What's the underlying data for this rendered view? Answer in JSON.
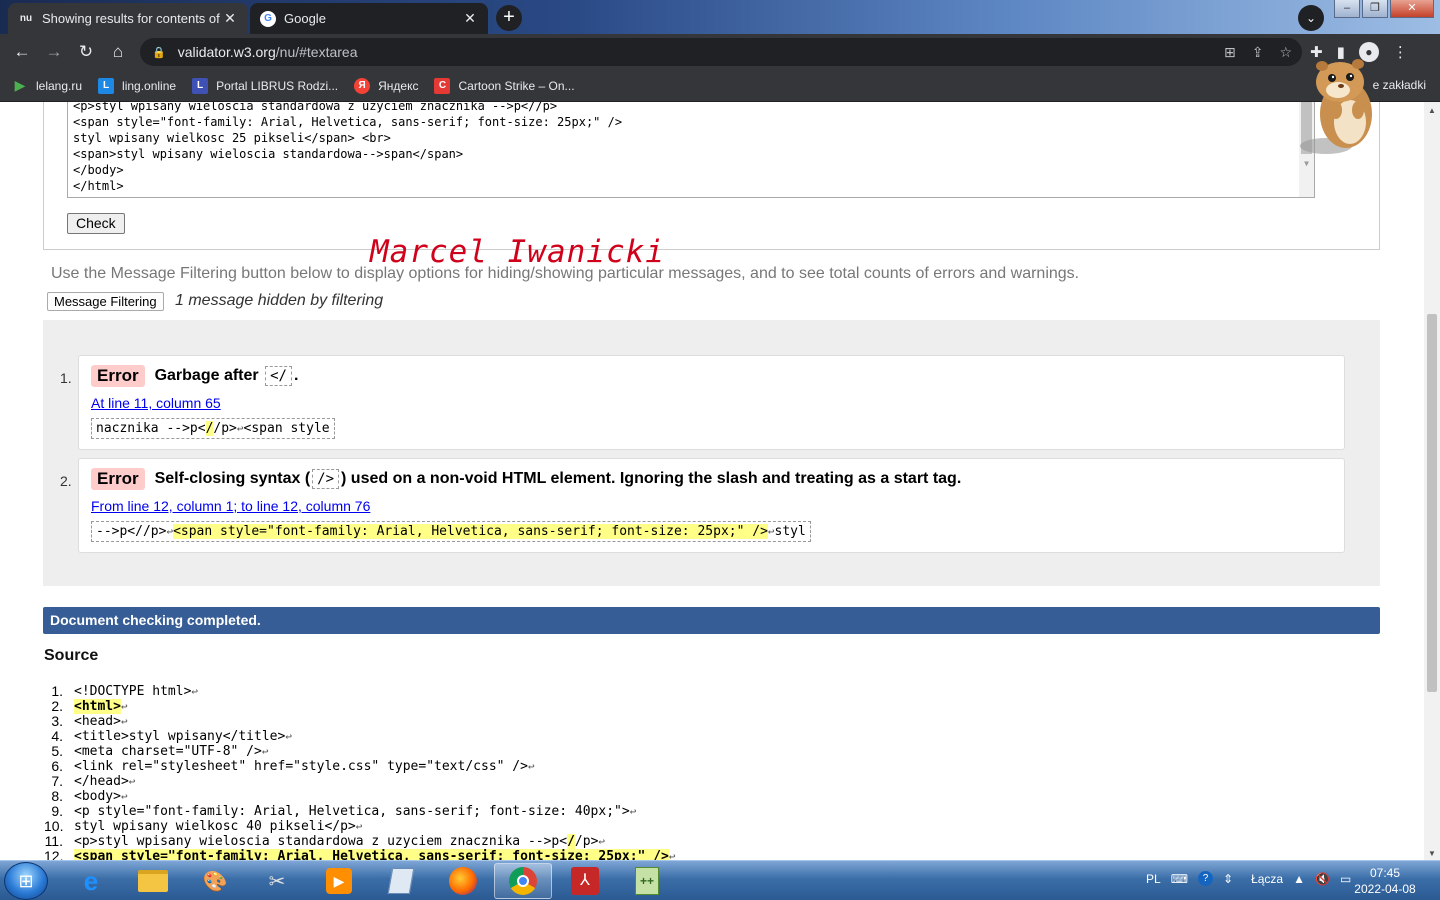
{
  "browser": {
    "tabs": [
      {
        "title": "Showing results for contents of te",
        "favicon": "nu"
      },
      {
        "title": "Google",
        "favicon": "G"
      }
    ],
    "url_prefix": "validator.w3.org",
    "url_path": "/nu/#textarea",
    "bookmarks": [
      {
        "label": "lelang.ru",
        "icon": "play-icon",
        "color": "#4caf50"
      },
      {
        "label": "ling.online",
        "icon": "L",
        "color": "#1e88e5"
      },
      {
        "label": "Portal LIBRUS Rodzi...",
        "icon": "L",
        "color": "#3f51b5"
      },
      {
        "label": "Яндекс",
        "icon": "Я",
        "color": "#f44336"
      },
      {
        "label": "Cartoon Strike – On...",
        "icon": "C",
        "color": "#e53935"
      }
    ],
    "other_bookmarks": "e zakładki"
  },
  "textarea": {
    "lines": [
      "<p>styl wpisany wieloscia standardowa z uzyciem znacznika -->p<//p>",
      "<span style=\"font-family: Arial, Helvetica, sans-serif; font-size: 25px;\" />",
      "styl wpisany wielkosc 25 pikseli</span> <br>",
      "<span>styl wpisany wieloscia standardowa-->span</span>",
      "</body>",
      "</html>"
    ]
  },
  "check_label": "Check",
  "signature": "Marcel Iwanicki",
  "filter_info": "Use the Message Filtering button below to display options for hiding/showing particular messages, and to see total counts of errors and warnings.",
  "filter_button": "Message Filtering",
  "hidden_msg": "1 message hidden by filtering",
  "messages": [
    {
      "num": "1.",
      "badge": "Error",
      "text_before": "Garbage after",
      "code": "</",
      "text_after": ".",
      "location": "At line 11, column 65",
      "extract_pre": "nacznika -->p<",
      "extract_hl": "/",
      "extract_post": "/p>",
      "extract_tail": "<span style"
    },
    {
      "num": "2.",
      "badge": "Error",
      "text_before": "Self-closing syntax (",
      "code": "/>",
      "text_after": ") used on a non-void HTML element. Ignoring the slash and treating as a start tag.",
      "location": "From line 12, column 1; to line 12, column 76",
      "extract_pre": "-->p<//p>",
      "extract_hl": "<span style=\"font-family: Arial, Helvetica, sans-serif; font-size: 25px;\" />",
      "extract_tail": "styl"
    }
  ],
  "done_text": "Document checking completed.",
  "source_title": "Source",
  "source_lines": [
    {
      "n": "1.",
      "pre": "<!DOCTYPE html>",
      "hl": "",
      "post": ""
    },
    {
      "n": "2.",
      "pre": "",
      "hl": "<html>",
      "post": ""
    },
    {
      "n": "3.",
      "pre": "<head>",
      "hl": "",
      "post": ""
    },
    {
      "n": "4.",
      "pre": "<title>styl wpisany</title>",
      "hl": "",
      "post": ""
    },
    {
      "n": "5.",
      "pre": "<meta charset=\"UTF-8\" />",
      "hl": "",
      "post": ""
    },
    {
      "n": "6.",
      "pre": "<link rel=\"stylesheet\" href=\"style.css\" type=\"text/css\" />",
      "hl": "",
      "post": ""
    },
    {
      "n": "7.",
      "pre": "</head>",
      "hl": "",
      "post": ""
    },
    {
      "n": "8.",
      "pre": "<body>",
      "hl": "",
      "post": ""
    },
    {
      "n": "9.",
      "pre": "<p style=\"font-family: Arial, Helvetica, sans-serif; font-size: 40px;\">",
      "hl": "",
      "post": ""
    },
    {
      "n": "10.",
      "pre": "styl wpisany wielkosc 40 pikseli</p>",
      "hl": "",
      "post": ""
    },
    {
      "n": "11.",
      "pre": "<p>styl wpisany wieloscia standardowa z uzyciem znacznika -->p<",
      "hl": "/",
      "post": "/p>"
    },
    {
      "n": "12.",
      "pre": "",
      "hl": "<span style=\"font-family: Arial, Helvetica, sans-serif; font-size: 25px;\" />",
      "post": ""
    }
  ],
  "return_glyph": "↩",
  "taskbar": {
    "lang": "PL",
    "network": "Łącza",
    "time": "07:45",
    "date": "2022-04-08"
  }
}
